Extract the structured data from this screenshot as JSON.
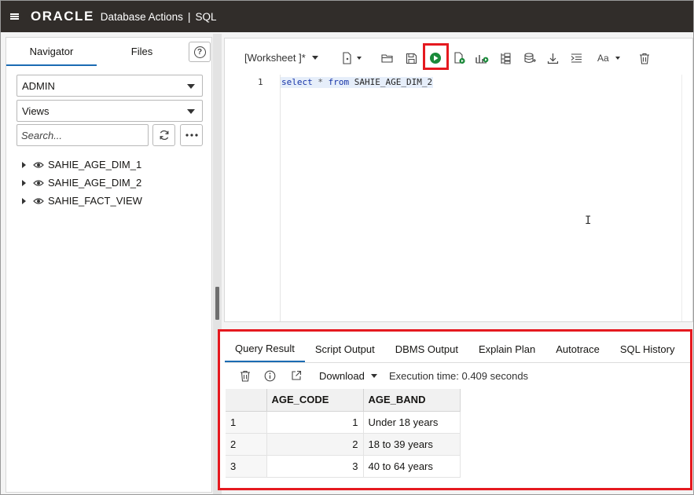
{
  "header": {
    "logo": "ORACLE",
    "app": "Database Actions",
    "separator": "|",
    "section": "SQL"
  },
  "navigator": {
    "tabs": [
      {
        "label": "Navigator",
        "active": true
      },
      {
        "label": "Files",
        "active": false
      }
    ],
    "schema": "ADMIN",
    "object_type": "Views",
    "search_placeholder": "Search...",
    "items": [
      {
        "label": "SAHIE_AGE_DIM_1"
      },
      {
        "label": "SAHIE_AGE_DIM_2"
      },
      {
        "label": "SAHIE_FACT_VIEW"
      }
    ]
  },
  "editor": {
    "worksheet_label": "[Worksheet ]*",
    "line_number": "1",
    "code": {
      "kw1": "select",
      "star": "*",
      "kw2": "from",
      "table": "SAHIE_AGE_DIM_2"
    },
    "highlight_color": "#e5191f",
    "run_color": "#1a8a3a"
  },
  "results": {
    "tabs": [
      {
        "label": "Query Result",
        "active": true
      },
      {
        "label": "Script Output",
        "active": false
      },
      {
        "label": "DBMS Output",
        "active": false
      },
      {
        "label": "Explain Plan",
        "active": false
      },
      {
        "label": "Autotrace",
        "active": false
      },
      {
        "label": "SQL History",
        "active": false
      }
    ],
    "download_label": "Download",
    "execution_time": "Execution time: 0.409 seconds",
    "columns": [
      "AGE_CODE",
      "AGE_BAND"
    ],
    "rows": [
      {
        "rn": "1",
        "age_code": "1",
        "age_band": "Under 18 years"
      },
      {
        "rn": "2",
        "age_code": "2",
        "age_band": "18 to 39 years"
      },
      {
        "rn": "3",
        "age_code": "3",
        "age_band": "40 to 64 years"
      }
    ]
  }
}
